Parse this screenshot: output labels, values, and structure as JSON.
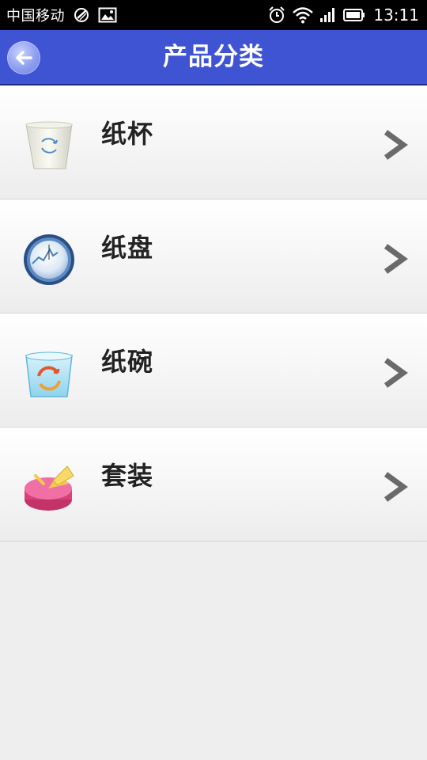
{
  "status_bar": {
    "carrier": "中国移动",
    "time": "13:11",
    "icons": [
      "nfc-icon",
      "image-icon",
      "alarm-icon",
      "wifi-icon",
      "signal-icon",
      "battery-icon"
    ]
  },
  "header": {
    "title": "产品分类",
    "back_icon": "back-arrow-icon"
  },
  "categories": [
    {
      "label": "纸杯",
      "icon": "paper-cup-icon"
    },
    {
      "label": "纸盘",
      "icon": "paper-plate-icon"
    },
    {
      "label": "纸碗",
      "icon": "paper-bowl-icon"
    },
    {
      "label": "套装",
      "icon": "set-pie-icon"
    }
  ],
  "colors": {
    "header_bg": "#3f54d3",
    "background": "#eeeeee",
    "label_text": "#222222",
    "chevron": "#6a6a6a"
  }
}
